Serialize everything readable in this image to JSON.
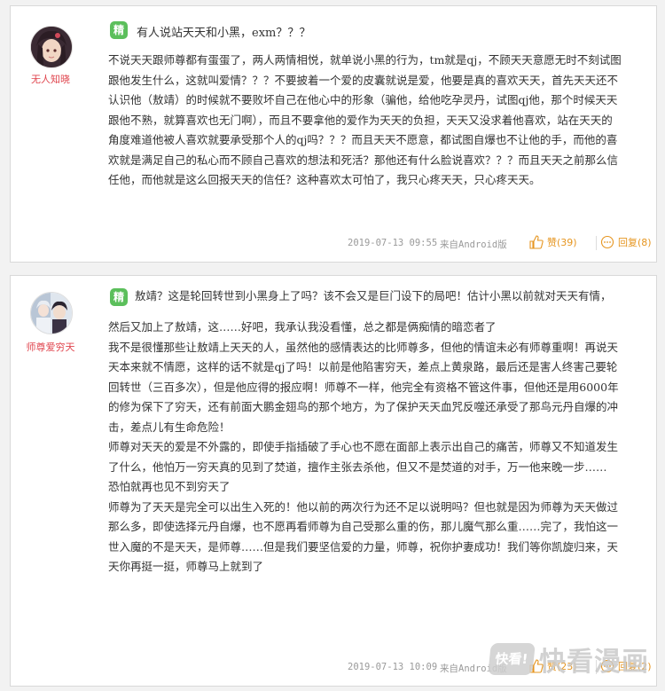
{
  "comments": [
    {
      "username": "无人知晓",
      "badge": "精",
      "title": "有人说站天天和小黑，exm？？？",
      "lines": [
        "不说天天跟师尊都有蛋蛋了，两人两情相悦，就单说小黑的行为，tm就是qj，不顾天天意愿无时不刻试图",
        "跟他发生什么，这就叫爱情？？？不要披着一个爱的皮囊就说是爱，他要是真的喜欢天天，首先天天还不",
        "认识他（敖靖）的时候就不要败坏自己在他心中的形象（骗他，给他吃孕灵丹，试图qj他，那个时候天天",
        "跟他不熟，就算喜欢也无门啊），而且不要拿他的爱作为天天的负担，天天又没求着他喜欢，站在天天的",
        "角度难道他被人喜欢就要承受那个人的qj吗？？？而且天天不愿意，都试图自爆也不让他的手，而他的喜",
        "欢就是满足自己的私心而不顾自己喜欢的想法和死活？那他还有什么脸说喜欢？？？而且天天之前那么信",
        "任他，而他就是这么回报天天的信任？这种喜欢太可怕了，我只心疼天天，只心疼天天。"
      ],
      "time": "2019-07-13 09:55",
      "source": "来自Android版",
      "like_label": "赞(39)",
      "reply_label": "回复(8)"
    },
    {
      "username": "师尊爱穷天",
      "badge": "精",
      "lines": [
        "敖靖？这是轮回转世到小黑身上了吗？该不会又是巨门设下的局吧！估计小黑以前就对天天有情，",
        "然后又加上了敖靖，这……好吧，我承认我没看懂，总之都是俩痴情的暗恋者了",
        "我不是很懂那些让敖靖上天天的人，虽然他的感情表达的比师尊多，但他的情谊未必有师尊重啊！再说天",
        "天本来就不情愿，这样的话不就是qj了吗！以前是他陷害穷天，差点上黄泉路，最后还是害人终害己要轮",
        "回转世（三百多次），但是他应得的报应啊！师尊不一样，他完全有资格不管这件事，但他还是用6000年",
        "的修为保下了穷天，还有前面大鹏金翅鸟的那个地方，为了保护天天血咒反噬还承受了那鸟元丹自爆的冲",
        "击，差点儿有生命危险！",
        "师尊对天天的爱是不外露的，即使手指插破了手心也不愿在面部上表示出自己的痛苦，师尊又不知道发生",
        "了什么，他怕万一穷天真的见到了焚道，擅作主张去杀他，但又不是焚道的对手，万一他来晚一步……",
        "恐怕就再也见不到穷天了",
        "师尊为了天天是完全可以出生入死的！他以前的两次行为还不足以说明吗？但也就是因为师尊为天天做过",
        "那么多，即使选择元丹自爆，也不愿再看师尊为自己受那么重的伤，那儿魔气那么重……完了，我怕这一",
        "世入魔的不是天天，是师尊……但是我们要坚信爱的力量，师尊，祝你护妻成功！我们等你凯旋归来，天",
        "天你再挺一挺，师尊马上就到了"
      ],
      "time": "2019-07-13 10:09",
      "source": "来自Android版",
      "like_label": "赞(23)",
      "reply_label": "回复(2)"
    }
  ],
  "watermark": {
    "badge": "快看!",
    "text": "快看漫画"
  },
  "colors": {
    "accent": "#e6951f",
    "username": "#e0464f",
    "badge": "#5bbf5b"
  }
}
